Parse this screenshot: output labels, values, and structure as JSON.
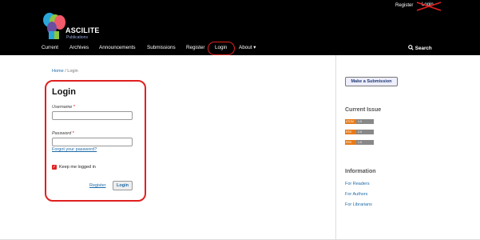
{
  "header": {
    "brand": "ASCILITE",
    "brand_sub": "Publications",
    "top_links": {
      "register": "Register",
      "login": "Login"
    },
    "nav": [
      {
        "label": "Current"
      },
      {
        "label": "Archives"
      },
      {
        "label": "Announcements"
      },
      {
        "label": "Submissions"
      },
      {
        "label": "Register"
      },
      {
        "label": "Login"
      },
      {
        "label": "About ▾"
      }
    ],
    "search": "Search"
  },
  "breadcrumb": {
    "home": "Home",
    "sep": "/",
    "current": "Login"
  },
  "login_form": {
    "title": "Login",
    "username_label": "Username",
    "password_label": "Password",
    "required_mark": "*",
    "forgot": "Forgot your password?",
    "keep_logged_in": "Keep me logged in",
    "keep_checked": true,
    "register_link": "Register",
    "login_button": "Login"
  },
  "sidebar": {
    "submit_button": "Make a Submission",
    "current_issue_heading": "Current Issue",
    "feeds": [
      {
        "left": "ATOM",
        "right": "1.0"
      },
      {
        "left": "RSS",
        "right": "2.0"
      },
      {
        "left": "RSS",
        "right": "1.0"
      }
    ],
    "information_heading": "Information",
    "info_links": [
      "For Readers",
      "For Authors",
      "For Librarians"
    ]
  },
  "colors": {
    "header_bg": "#000000",
    "link": "#1e6ba8",
    "annotation": "#e02020",
    "feed_orange": "#e77b1a"
  }
}
